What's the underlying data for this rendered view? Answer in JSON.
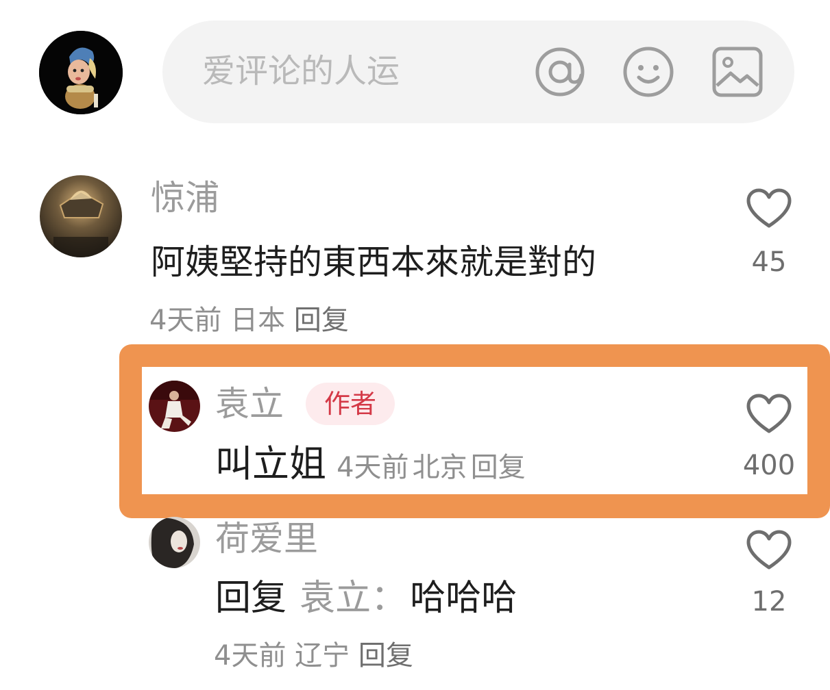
{
  "composer": {
    "placeholder": "爱评论的人运",
    "at_icon": "at-icon",
    "emoji_icon": "smiley-icon",
    "image_icon": "image-icon"
  },
  "comments": [
    {
      "username": "惊浦",
      "text": "阿姨堅持的東西本來就是對的",
      "time": "4天前",
      "location": "日本",
      "reply_label": "回复",
      "likes": "45"
    }
  ],
  "author_reply": {
    "username": "袁立",
    "badge": "作者",
    "text": "叫立姐",
    "time": "4天前",
    "location": "北京",
    "reply_label": "回复",
    "likes": "400"
  },
  "sub_reply": {
    "username": "荷爱里",
    "reply_prefix": "回复",
    "reply_to": "袁立：",
    "text": "哈哈哈",
    "time": "4天前",
    "location": "辽宁",
    "reply_label": "回复",
    "likes": "12"
  },
  "colors": {
    "highlight_border": "#ef9450",
    "badge_bg": "#fdebed",
    "badge_text": "#d43947"
  }
}
